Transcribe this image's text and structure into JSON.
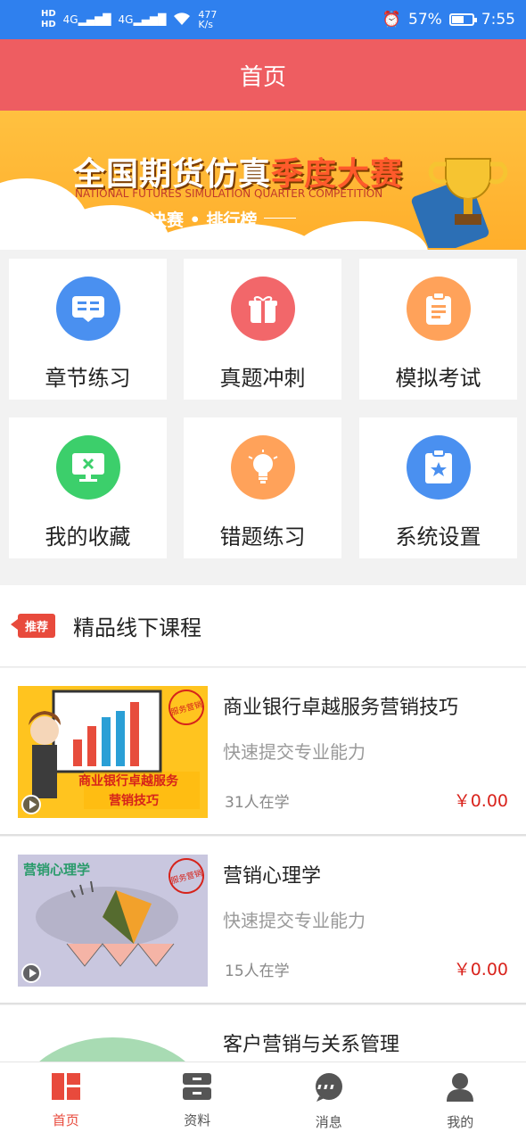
{
  "status_bar": {
    "network_left": "HD",
    "signal1": "4G",
    "signal2": "4G",
    "speed_value": "477",
    "speed_unit": "K/s",
    "battery": "57%",
    "time": "7:55"
  },
  "header": {
    "title": "首页"
  },
  "banner": {
    "title_main": "全国期货仿真",
    "title_highlight": "季度大赛",
    "subtitle": "NATIONAL FUTURES SIMULATION QUARTER COMPETITION",
    "final_text": "决赛 • 排行榜"
  },
  "grid": [
    {
      "label": "章节练习",
      "icon": "book-icon",
      "color": "#4a90f0"
    },
    {
      "label": "真题冲刺",
      "icon": "gift-icon",
      "color": "#f2676a"
    },
    {
      "label": "模拟考试",
      "icon": "clipboard-icon",
      "color": "#ffa25a"
    },
    {
      "label": "我的收藏",
      "icon": "monitor-icon",
      "color": "#3ccf6b"
    },
    {
      "label": "错题练习",
      "icon": "lightbulb-icon",
      "color": "#ffa25a"
    },
    {
      "label": "系统设置",
      "icon": "badge-star-icon",
      "color": "#4a90f0"
    }
  ],
  "section": {
    "tag": "推荐",
    "title": "精品线下课程"
  },
  "courses": [
    {
      "title": "商业银行卓越服务营销技巧",
      "desc": "快速提交专业能力",
      "learners": "31人在学",
      "price": "￥0.00",
      "thumb_text_1": "商业银行卓越服务",
      "thumb_text_2": "营销技巧",
      "thumb_stamp": "服务营销"
    },
    {
      "title": "营销心理学",
      "desc": "快速提交专业能力",
      "learners": "15人在学",
      "price": "￥0.00",
      "thumb_text_1": "营销心理学",
      "thumb_stamp": "服务营销"
    },
    {
      "title": "客户营销与关系管理"
    }
  ],
  "bottom_nav": [
    {
      "label": "首页",
      "icon": "home-grid-icon",
      "active": true
    },
    {
      "label": "资料",
      "icon": "drawer-icon",
      "active": false
    },
    {
      "label": "消息",
      "icon": "chat-bubble-icon",
      "active": false
    },
    {
      "label": "我的",
      "icon": "user-icon",
      "active": false
    }
  ],
  "colors": {
    "status_bar": "#2f80ee",
    "header": "#ee5d61",
    "accent": "#e84a3c",
    "price": "#d9231c"
  }
}
